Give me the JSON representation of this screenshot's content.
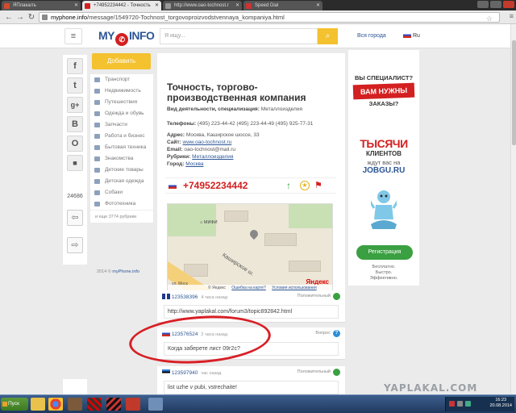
{
  "browser": {
    "tabs": [
      {
        "label": "ЯПлакалъ",
        "active": false
      },
      {
        "label": "+74952234442 - Точность",
        "active": true
      },
      {
        "label": "http://www.oao-tochnost.r",
        "active": false
      },
      {
        "label": "Speed Dial",
        "active": false
      }
    ],
    "url_host": "myphone.info",
    "url_path": "/message/1549720-Tochnost_torgovoproizvodstvennaya_kompaniya.html"
  },
  "header": {
    "logo_left": "MY",
    "logo_right": "INFO",
    "search_placeholder": "Я ищу...",
    "all_cities": "Вся города",
    "lang": "Ru"
  },
  "social": {
    "buttons": [
      "f",
      "t",
      "g+",
      "B",
      "O",
      "■"
    ],
    "share_count": "24686"
  },
  "sidebar": {
    "add_button": "Добавить",
    "categories": [
      "Транспорт",
      "Недвижимость",
      "Путешествия",
      "Одежда и обувь",
      "Запчасти",
      "Работа и бизнес",
      "Бытовая техника",
      "Знакомства",
      "Детские товары",
      "Детская одежда",
      "Собаки",
      "Фототехника"
    ],
    "more": "и еще 3774 рубрики",
    "copyright": "2014 ©",
    "copyright_link": "myPhone.info"
  },
  "company": {
    "title": "Точность, торгово-производственная компания",
    "activity_label": "Вид деятельности, специализация:",
    "activity_value": "Металлоизделия",
    "phones_label": "Телефоны:",
    "phones_value": "(495) 223-44-42 (495) 223-44-49 (495) 925-77-31",
    "address_label": "Адрес:",
    "address_value": "Москва, Каширское шоссе, 33",
    "site_label": "Сайт:",
    "site_value": "www.oao-tochnost.ru",
    "email_label": "Email:",
    "email_value": "oao-tochnost@mail.ru",
    "rubric_label": "Рубрики:",
    "rubric_value": "Металлоизделия",
    "city_label": "Город:",
    "city_value": "Москва",
    "phone_big": "+74952234442"
  },
  "map": {
    "street": "Каширское ш.",
    "school": "МИФИ",
    "small_label": "ул. Моск",
    "logo": "Яндекс",
    "footer_copy": "© Яндекс",
    "footer_error": "Ошибка на карте?",
    "footer_terms": "Условия использования"
  },
  "ad": {
    "question": "ВЫ СПЕЦИАЛИСТ?",
    "need": "ВАМ НУЖНЫ",
    "orders": "ЗАКАЗЫ?",
    "thousands": "ТЫСЯЧИ",
    "clients": "КЛИЕНТОВ",
    "wait": "ждут вас на",
    "jobgu": "JOBGU.RU",
    "register": "Регистрация",
    "fine1": "Бесплатно.",
    "fine2": "Быстро.",
    "fine3": "Эффективно."
  },
  "comments": [
    {
      "user": "123538396",
      "time": "4 часа назад",
      "type": "Положительный",
      "text": "http://www.yaplakal.com/forum3/topic892842.html"
    },
    {
      "user": "123576524",
      "time": "2 часа назад",
      "type": "Вопрос",
      "text": "Когда заберете лист 09г2с?"
    },
    {
      "user": "123597940",
      "time": "час назад",
      "type": "Положительный",
      "text": "list uzhe v pubi, vstrechaite!"
    }
  ],
  "watermark": "YAPLAKAL.COM",
  "taskbar": {
    "start": "Пуск",
    "time": "16:23",
    "date": "20.08.2014"
  },
  "colors": {
    "brand_blue": "#2d5696",
    "accent_red": "#d32020",
    "button_yellow": "#f4c12f",
    "green": "#3aa041"
  }
}
